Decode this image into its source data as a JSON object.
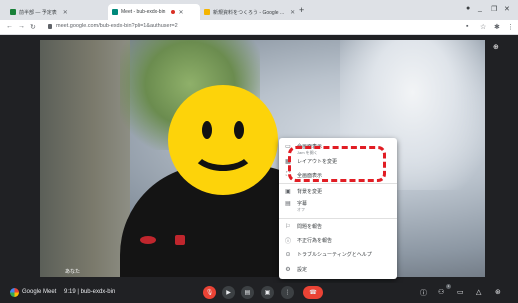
{
  "browser": {
    "tabs": [
      {
        "title": "前半部 — 予定表",
        "icon": "sheets-icon",
        "color": "#188038"
      },
      {
        "title": "Meet - bub-exdx-bin",
        "icon": "meet-icon",
        "color": "#00897b"
      },
      {
        "title": "新規資料をつくろう - Google ...",
        "icon": "slides-icon",
        "color": "#f4b400"
      }
    ],
    "url": "meet.google.com/bub-exdx-bin?pli=1&authuser=2",
    "window_controls": [
      "_",
      "❐",
      "✕"
    ]
  },
  "meet": {
    "participant_name": "あなた",
    "brand": "Google Meet",
    "meeting_info": "9:19 | bub-exdx-bin",
    "more_menu": {
      "items": [
        {
          "label": "全画面表示",
          "sub": "Jam を開く",
          "icon": "fullscreen-icon"
        },
        {
          "label": "レイアウトを変更",
          "icon": "layout-icon"
        },
        {
          "label": "全画面表示",
          "icon": "fullscreen-icon"
        },
        {
          "label": "背景を変更",
          "icon": "background-icon"
        },
        {
          "label": "字幕",
          "sub": "オフ",
          "icon": "captions-icon"
        },
        {
          "label": "問題を報告",
          "icon": "report-icon"
        },
        {
          "label": "不正行為を報告",
          "icon": "warning-icon"
        },
        {
          "label": "トラブルシューティングとヘルプ",
          "icon": "troubleshoot-icon"
        },
        {
          "label": "設定",
          "icon": "settings-icon"
        }
      ]
    },
    "participants_count": "1",
    "colors": {
      "accent_red": "#ea4335",
      "highlight": "#e11d24",
      "bg": "#202124",
      "smiley": "#fdd30a"
    }
  }
}
